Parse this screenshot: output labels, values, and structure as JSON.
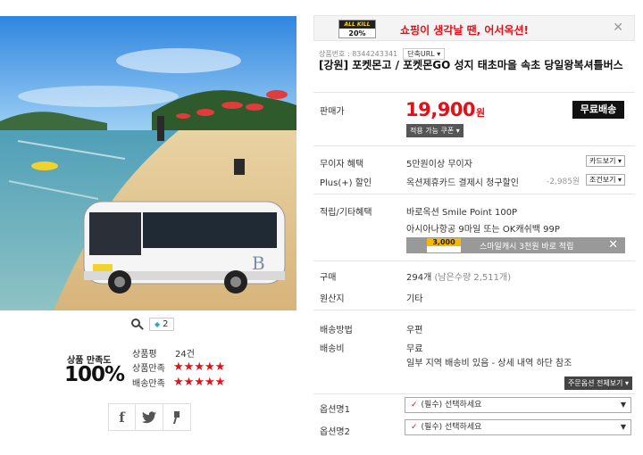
{
  "banner": {
    "allkill_top": "ALL KILL",
    "allkill_bottom": "20%",
    "text": "쇼핑이 생각날 땐, 어서옥션!",
    "close": "✕"
  },
  "product": {
    "code_label": "상품번호 : 8344243341",
    "short_url": "단축URL",
    "title": "[강원] 포켓몬고 / 포켓몬GO 성지 태초마을 속초 당일왕복셔틀버스"
  },
  "price": {
    "label": "판매가",
    "value": "19,900",
    "unit": "원",
    "free_shipping": "무료배송",
    "coupon_button": "적용 가능 쿠폰"
  },
  "benefits": {
    "interest_free_label": "무이자 혜택",
    "interest_free_value": "5만원이상 무이자",
    "card_view": "카드보기",
    "plus_label": "Plus(+) 할인",
    "plus_value": "옥션제휴카드 결제시 청구할인",
    "plus_amount": "-2,985원",
    "condition_view": "조건보기",
    "point_label": "적립/기타혜택",
    "point_value_1": "바로옥션 Smile Point 100P",
    "point_value_2": "아시아나항공 9마일 또는 OK캐쉬백 99P",
    "smilecash_badge": "3,000",
    "smilecash_text": "스마일캐시 3천원 바로 적립",
    "smilecash_close": "✕"
  },
  "purchase": {
    "label": "구매",
    "value": "294개",
    "remaining": "(남은수량 2,511개)",
    "origin_label": "원산지",
    "origin_value": "기타"
  },
  "delivery": {
    "method_label": "배송방법",
    "method_value": "우편",
    "fee_label": "배송비",
    "fee_value": "무료",
    "fee_note": "일부 지역 배송비 있음 - 상세 내역 하단 참조"
  },
  "options": {
    "view_all": "주문옵션 전체보기",
    "items": [
      {
        "label": "옵션명1",
        "value": "(필수) 선택하세요"
      },
      {
        "label": "옵션명2",
        "value": "(필수) 선택하세요"
      }
    ]
  },
  "gallery": {
    "share_count": "2"
  },
  "satisfaction": {
    "title": "상품 만족도",
    "percent": "100%",
    "review_label": "상품평",
    "review_count": "24건",
    "product_label": "상품만족",
    "delivery_label": "배송만족",
    "product_stars": 5,
    "delivery_stars": 5
  },
  "share": {
    "facebook": "f",
    "twitter": "t",
    "story": "s"
  },
  "colors": {
    "accent": "#e3101a",
    "dark": "#111111"
  }
}
